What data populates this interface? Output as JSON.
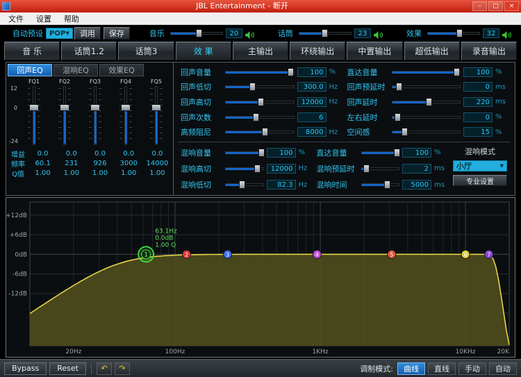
{
  "window": {
    "title": "JBL Entertainment - 断开",
    "minimize": "–",
    "maximize": "□",
    "close": "×"
  },
  "menu": {
    "items": [
      "文件",
      "设置",
      "帮助"
    ]
  },
  "toolbar": {
    "preset_label": "自动预设",
    "preset": {
      "value": "POP",
      "arrow": "▼"
    },
    "recall": "调用",
    "save": "保存",
    "music": {
      "label": "音乐",
      "value": "20",
      "pct": 55
    },
    "mic": {
      "label": "话筒",
      "value": "23",
      "pct": 50
    },
    "effect": {
      "label": "效果",
      "value": "32",
      "pct": 62
    }
  },
  "tabs": {
    "items": [
      "音 乐",
      "话筒1.2",
      "话筒3",
      "效 果",
      "主输出",
      "环绕输出",
      "中置输出",
      "超低输出",
      "录音输出"
    ],
    "active": "效 果"
  },
  "eq_panel": {
    "tabs": [
      "回声EQ",
      "混响EQ",
      "效果EQ"
    ],
    "active_tab": "回声EQ",
    "scale_top": "12",
    "scale_zero": "0",
    "scale_bottom": "-24",
    "row_labels": {
      "gain": "增益",
      "freq": "频率",
      "q": "Q值"
    },
    "bands": [
      {
        "name": "FQ1",
        "gain": "0.0",
        "freq": "60.1",
        "q": "1.00"
      },
      {
        "name": "FQ2",
        "gain": "0.0",
        "freq": "231",
        "q": "1.00"
      },
      {
        "name": "FQ3",
        "gain": "0.0",
        "freq": "926",
        "q": "1.00"
      },
      {
        "name": "FQ4",
        "gain": "0.0",
        "freq": "3000",
        "q": "1.00"
      },
      {
        "name": "FQ5",
        "gain": "0.0",
        "freq": "14000",
        "q": "1.00"
      }
    ]
  },
  "echo": {
    "left": [
      {
        "label": "回声音量",
        "value": "100",
        "unit": "%",
        "pct": 95
      },
      {
        "label": "回声低切",
        "value": "300.0",
        "unit": "Hz",
        "pct": 40
      },
      {
        "label": "回声高切",
        "value": "12000",
        "unit": "Hz",
        "pct": 52
      },
      {
        "label": "回声次数",
        "value": "6",
        "unit": "",
        "pct": 45
      },
      {
        "label": "高频阻尼",
        "value": "8000",
        "unit": "Hz",
        "pct": 58
      }
    ],
    "right": [
      {
        "label": "直达音量",
        "value": "100",
        "unit": "%",
        "pct": 95
      },
      {
        "label": "回声预延时",
        "value": "0",
        "unit": "ms",
        "pct": 12
      },
      {
        "label": "回声延时",
        "value": "220",
        "unit": "ms",
        "pct": 55
      },
      {
        "label": "左右延时",
        "value": "0",
        "unit": "%",
        "pct": 10
      },
      {
        "label": "空间感",
        "value": "15",
        "unit": "%",
        "pct": 20
      }
    ]
  },
  "reverb": {
    "left": [
      {
        "label": "混响音量",
        "value": "100",
        "unit": "%",
        "pct": 95
      },
      {
        "label": "混响高切",
        "value": "12000",
        "unit": "Hz",
        "pct": 85
      },
      {
        "label": "混响低切",
        "value": "82.3",
        "unit": "Hz",
        "pct": 45
      }
    ],
    "right": [
      {
        "label": "直达音量",
        "value": "100",
        "unit": "%",
        "pct": 95
      },
      {
        "label": "混响预延时",
        "value": "2",
        "unit": "ms",
        "pct": 15
      },
      {
        "label": "混响时间",
        "value": "5000",
        "unit": "ms",
        "pct": 70
      }
    ],
    "mode": {
      "label": "混响模式",
      "value": "小厅",
      "arrow": "▼",
      "settings": "专业设置"
    }
  },
  "chart_data": {
    "type": "line",
    "title": "EQ frequency response curve",
    "x_labels": [
      "20Hz",
      "100Hz",
      "1KHz",
      "10KHz",
      "20K"
    ],
    "x_label_freqs": [
      20,
      100,
      1000,
      10000,
      20000
    ],
    "y_labels": [
      "+12dB",
      "+6dB",
      "0dB",
      "-6dB",
      "-12dB"
    ],
    "y_label_dbs": [
      12,
      6,
      0,
      -6,
      -12
    ],
    "grid_dbs": [
      12,
      6,
      0,
      -6,
      -12,
      -18,
      -24
    ],
    "y_range": [
      16,
      -28
    ],
    "x_range_hz": [
      10,
      20000
    ],
    "curve": {
      "shape": "bandpass",
      "highpass_hz": 40,
      "hp_order": 3,
      "lowpass_hz": 16000,
      "lp_order": 30,
      "flat_db": 0
    },
    "tooltip": [
      "63.1Hz",
      "0.0dB",
      "1.00 Q"
    ],
    "points": [
      {
        "n": "1",
        "freq": 63.1,
        "db": 0,
        "color": "#44d844",
        "selected": true
      },
      {
        "n": "2",
        "freq": 120,
        "db": 0,
        "color": "#e03838",
        "selected": false
      },
      {
        "n": "3",
        "freq": 230,
        "db": 0,
        "color": "#3f6fe8",
        "selected": false
      },
      {
        "n": "4",
        "freq": 950,
        "db": 0,
        "color": "#c44ee0",
        "selected": false
      },
      {
        "n": "5",
        "freq": 3100,
        "db": 0,
        "color": "#e05838",
        "selected": false
      },
      {
        "n": "6",
        "freq": 10000,
        "db": 0,
        "color": "#ded23c",
        "selected": false
      },
      {
        "n": "7",
        "freq": 14500,
        "db": 0,
        "color": "#8a46d8",
        "selected": false
      }
    ]
  },
  "bottombar": {
    "bypass": "Bypass",
    "reset": "Reset",
    "undo_icon": "↶",
    "redo_icon": "↷",
    "mode_label": "调制模式:",
    "modes": [
      "曲线",
      "直线",
      "手动",
      "自动"
    ],
    "active_mode": "曲线"
  },
  "colors": {
    "accent_cyan": "#2fc6f2",
    "slider_blue": "#1565c8",
    "titlebar_red": "#c11d0c",
    "curve_yellow": "#e6d44a",
    "selected_point_green": "#3fd43f"
  }
}
